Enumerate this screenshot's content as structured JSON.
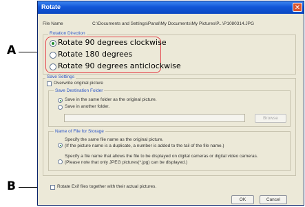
{
  "callouts": {
    "a": "A",
    "b": "B"
  },
  "window": {
    "title": "Rotate",
    "close_glyph": "✕"
  },
  "file_name": {
    "label": "File Name",
    "value": "C:\\Documents and Settings\\Panal\\My Documents\\My Pictures\\P...\\P1080314.JPG"
  },
  "rotation_direction": {
    "label": "Rotation Direction",
    "options": [
      {
        "label": "Rotate 90 degrees clockwise",
        "selected": true
      },
      {
        "label": "Rotate 180 degrees",
        "selected": false
      },
      {
        "label": "Rotate 90 degrees anticlockwise",
        "selected": false
      }
    ]
  },
  "save_settings": {
    "label": "Save Settings",
    "overwrite_label": "Overwrite original picture",
    "overwrite_checked": false,
    "destination": {
      "label": "Save Destination Folder",
      "same_folder_label": "Save in the same folder as the original picture.",
      "another_folder_label": "Save in another folder.",
      "selected": "same_folder",
      "browse_label": "Browse"
    },
    "file_name_storage": {
      "label": "Name of File for Storage",
      "option1_line1": "Specify the same file name as the original picture.",
      "option1_line2": "(If the picture name is a duplicate, a number is added to the tail of the file name.)",
      "option2_line1": "Specify a file name that allows the file to be displayed on digital cameras or digital video cameras.",
      "option2_line2": "(Please note that only JPEG pictures(*.jpg) can be displayed.)",
      "selected": 1
    }
  },
  "exif": {
    "label": "Rotate Exif files together with their actual pictures.",
    "checked": false
  },
  "buttons": {
    "ok": "OK",
    "cancel": "Cancel"
  },
  "colors": {
    "highlight": "#e4434a",
    "titlebar": "#1257d8",
    "group_label": "#2b55c8"
  }
}
